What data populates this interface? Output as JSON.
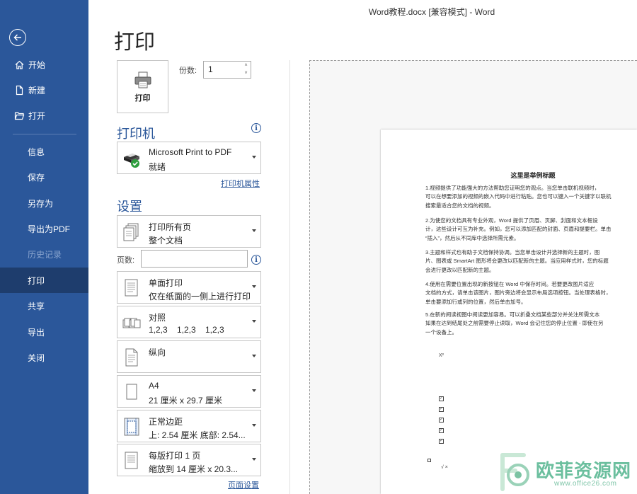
{
  "window": {
    "title": "Word教程.docx [兼容模式]  -  Word"
  },
  "sidebar": {
    "back_icon": "back-arrow-icon",
    "items": [
      {
        "label": "开始",
        "icon": "home-icon"
      },
      {
        "label": "新建",
        "icon": "new-doc-icon"
      },
      {
        "label": "打开",
        "icon": "folder-open-icon"
      },
      {
        "label": "信息"
      },
      {
        "label": "保存"
      },
      {
        "label": "另存为"
      },
      {
        "label": "导出为PDF"
      },
      {
        "label": "历史记录",
        "disabled": true
      },
      {
        "label": "打印",
        "active": true
      },
      {
        "label": "共享"
      },
      {
        "label": "导出"
      },
      {
        "label": "关闭"
      }
    ]
  },
  "main": {
    "heading": "打印",
    "print_button_label": "打印",
    "copies": {
      "label": "份数:",
      "value": "1"
    },
    "printer": {
      "heading": "打印机",
      "name": "Microsoft Print to PDF",
      "status": "就绪",
      "properties_link": "打印机属性"
    },
    "settings": {
      "heading": "设置",
      "range": {
        "main": "打印所有页",
        "sub": "整个文档"
      },
      "pages_label": "页数:",
      "pages_value": "",
      "sides": {
        "main": "单面打印",
        "sub": "仅在纸面的一侧上进行打印"
      },
      "collate": {
        "main": "对照",
        "sub": [
          "1,2,3",
          "1,2,3",
          "1,2,3"
        ]
      },
      "orientation": {
        "main": "纵向"
      },
      "paper": {
        "main": "A4",
        "sub": "21 厘米 x 29.7 厘米"
      },
      "margins": {
        "main": "正常边距",
        "sub": "上: 2.54 厘米 底部: 2.54..."
      },
      "per_sheet": {
        "main": "每版打印 1 页",
        "sub": "缩放到 14 厘米 x 20.3..."
      },
      "page_setup_link": "页面设置"
    }
  },
  "preview": {
    "doc_title": "这里是举例标题",
    "paragraphs": [
      "1.视频提供了功能强大的方法帮助您证明您的观点。当您单击联机视频时，\n可以在想要添加的视频的嵌入代码中进行粘贴。您也可以键入一个关键字以联机\n搜索最适合您的文档的视频。",
      "2.为使您的文档具有专业外观，Word 提供了页眉、页脚、封面和文本框设\n计，这些设计可互为补充。例如，您可以添加匹配的封面、页眉和提要栏。单击\n“插入”，然后从不同库中选择所需元素。",
      "3.主题和样式也有助于文档保持协调。当您单击设计并选择新的主题时，图\n片、图表或 SmartArt 图形将会更改以匹配新的主题。当应用样式时，您的标题\n会进行更改以匹配新的主题。",
      "4.使用在需要位置出现的新按钮在 Word 中保存时间。若要更改图片适应\n文档的方式，请单击该图片，图片旁边将会显示布局选项按钮。当处理表格时，\n单击要添加行或列的位置，然后单击加号。",
      "5.在新的阅读视图中阅读更加容易。可以折叠文档某些部分并关注所需文本\n如果在达到结尾处之前需要停止读取，Word 会记住您的停止位置 - 即使在另\n一个设备上。"
    ],
    "superscript": "X²",
    "checkmark": "√  ×"
  },
  "watermark": {
    "text": "欧菲资源网",
    "url": "www.office26.com"
  }
}
